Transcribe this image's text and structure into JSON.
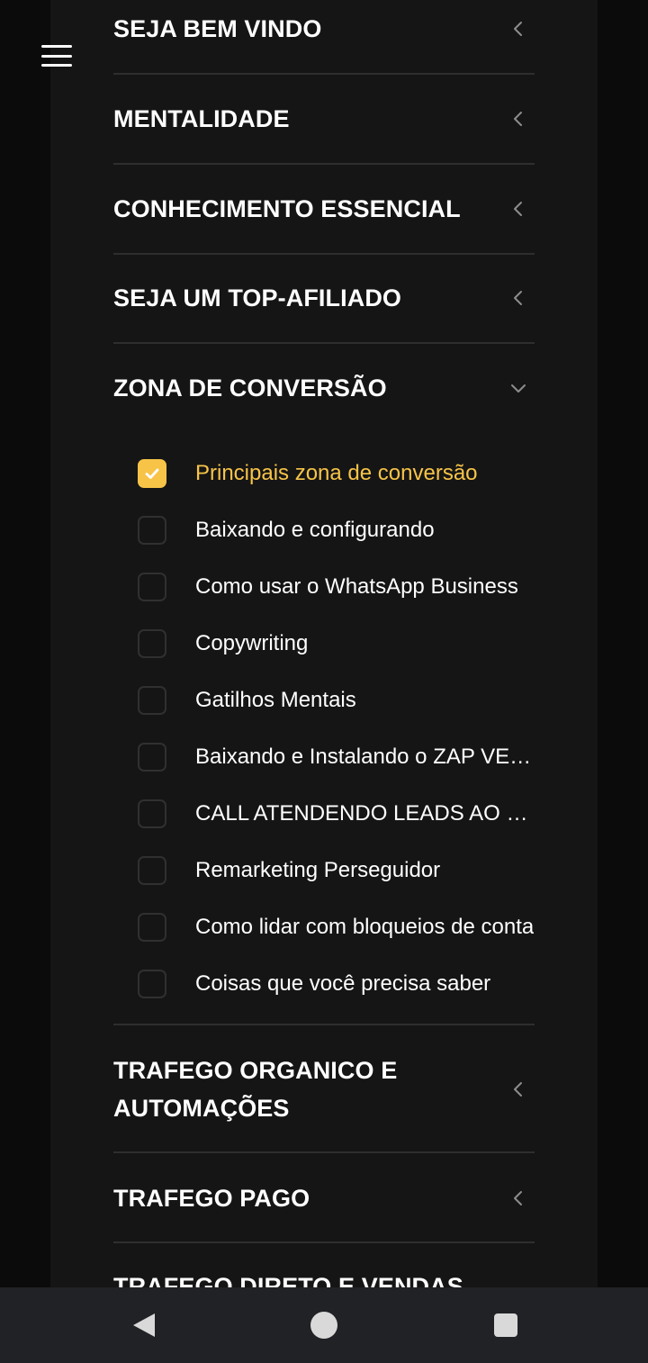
{
  "menu": {
    "icon": "hamburger-menu-icon"
  },
  "modules": [
    {
      "title": "SEJA BEM VINDO",
      "expanded": false
    },
    {
      "title": "MENTALIDADE",
      "expanded": false
    },
    {
      "title": "CONHECIMENTO ESSENCIAL",
      "expanded": false
    },
    {
      "title": "SEJA UM TOP-AFILIADO",
      "expanded": false
    },
    {
      "title": "ZONA DE CONVERSÃO",
      "expanded": true
    },
    {
      "title_line1": "TRAFEGO ORGANICO E",
      "title_line2": "AUTOMAÇÕES",
      "expanded": false
    },
    {
      "title": "TRAFEGO PAGO",
      "expanded": false
    },
    {
      "title": "TRAFEGO DIRETO E VENDAS",
      "expanded": false
    }
  ],
  "lessons": [
    {
      "label": "Principais zona de conversão",
      "completed": true
    },
    {
      "label": "Baixando e configurando",
      "completed": false
    },
    {
      "label": "Como usar o WhatsApp Business",
      "completed": false
    },
    {
      "label": "Copywriting",
      "completed": false
    },
    {
      "label": "Gatilhos Mentais",
      "completed": false
    },
    {
      "label": "Baixando e Instalando o ZAP VERDE",
      "completed": false
    },
    {
      "label": "CALL ATENDENDO LEADS AO VIVO",
      "completed": false
    },
    {
      "label": "Remarketing Perseguidor",
      "completed": false
    },
    {
      "label": "Como lidar com bloqueios de conta",
      "completed": false
    },
    {
      "label": "Coisas que você precisa saber",
      "completed": false
    }
  ],
  "colors": {
    "accent": "#f7c448",
    "panel": "#151515",
    "background": "#0b0b0b",
    "divider": "#2e2e2e",
    "navbar": "#212226"
  },
  "navbar": {
    "back": "back-triangle-icon",
    "home": "home-circle-icon",
    "recents": "recents-square-icon"
  }
}
